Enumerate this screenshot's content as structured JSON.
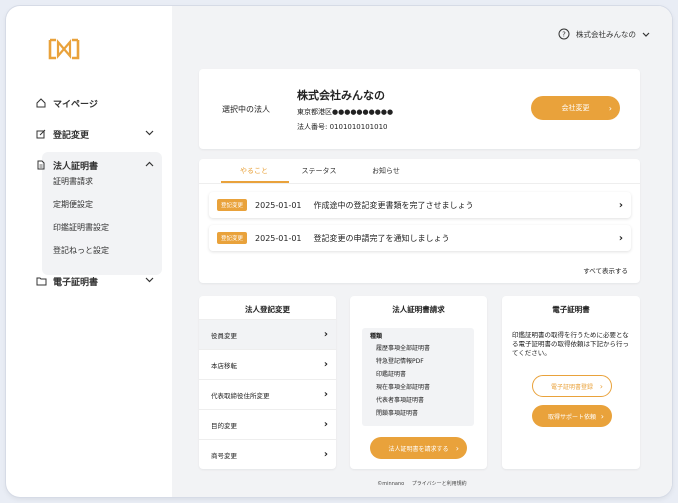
{
  "sidebar": {
    "items": [
      {
        "label": "マイページ"
      },
      {
        "label": "登記変更"
      },
      {
        "label": "法人証明書"
      },
      {
        "label": "電子証明書"
      }
    ],
    "sub_items": [
      "証明書請求",
      "定期便設定",
      "印鑑証明書設定",
      "登記ねっと設定"
    ]
  },
  "header": {
    "company_menu": "株式会社みんなの"
  },
  "company_card": {
    "label": "選択中の法人",
    "name": "株式会社みんなの",
    "address": "東京都港区●●●●●●●●●●",
    "corp_number": "法人番号: 0101010101010",
    "change_button": "会社変更"
  },
  "tabs": [
    {
      "label": "やること"
    },
    {
      "label": "ステータス"
    },
    {
      "label": "お知らせ"
    }
  ],
  "tasks": [
    {
      "badge": "登記変更",
      "date": "2025-01-01",
      "text": "作成途中の登記変更書類を完了させましょう"
    },
    {
      "badge": "登記変更",
      "date": "2025-01-01",
      "text": "登記変更の申請完了を通知しましょう"
    }
  ],
  "show_all": "すべて表示する",
  "registration_card": {
    "title": "法人登記変更",
    "rows": [
      "役員変更",
      "本店移転",
      "代表取締役住所変更",
      "目的変更",
      "商号変更"
    ]
  },
  "certificate_card": {
    "title": "法人証明書請求",
    "types_label": "種類",
    "types": [
      "履歴事項全部証明書",
      "特急登記情報PDF",
      "印鑑証明書",
      "現在事項全部証明書",
      "代表者事項証明書",
      "閉鎖事項証明書"
    ],
    "button": "法人証明書を請求する"
  },
  "e_cert_card": {
    "title": "電子証明書",
    "description": "印鑑証明書の取得を行うために必要となる電子証明書の取得依頼は下記から行ってください。",
    "register_button": "電子証明書登録",
    "support_button": "取得サポート依頼"
  },
  "footer": {
    "copyright": "©minnano",
    "privacy": "プライバシーと利用規約"
  },
  "colors": {
    "accent": "#e9a23b",
    "background": "#f2f3f5"
  }
}
